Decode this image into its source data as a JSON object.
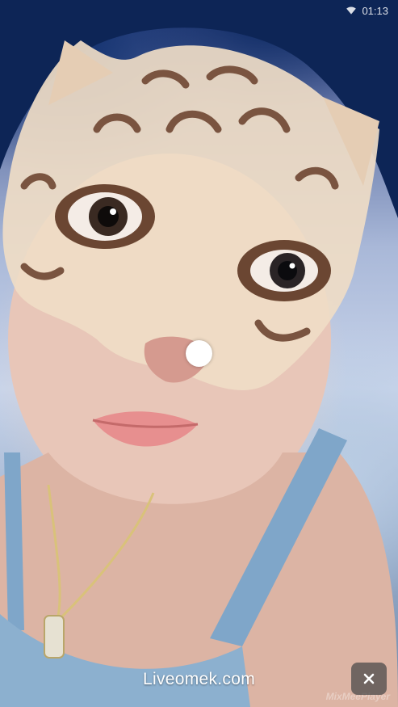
{
  "status_bar": {
    "time": "01:13",
    "wifi_icon": "wifi-icon"
  },
  "overlay": {
    "watermark": "Liveomek.com",
    "player_label": "MixMeePlayer",
    "close_icon": "close-icon"
  },
  "colors": {
    "background_top": "#2a3f7e",
    "background_bottom": "#6e87a8",
    "close_button_bg": "#464646",
    "watermark_text": "#ffffff"
  }
}
